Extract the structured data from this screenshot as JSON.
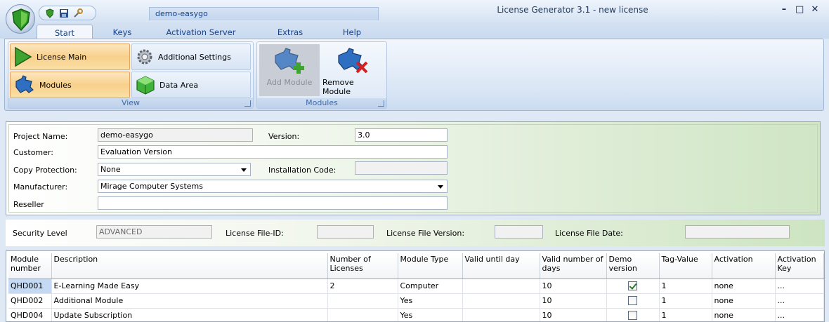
{
  "window": {
    "title": "License Generator 3.1 - new license",
    "document_tab": "demo-easygo",
    "controls": {
      "minimize": "–",
      "maximize": "□",
      "close": "✕"
    }
  },
  "ribbon": {
    "tabs": [
      "Start",
      "Keys",
      "Activation Server",
      "Extras",
      "Help"
    ],
    "active_tab": "Start",
    "view_group": {
      "label": "View",
      "buttons": {
        "license_main": "License Main",
        "additional_settings": "Additional Settings",
        "modules": "Modules",
        "data_area": "Data Area"
      }
    },
    "modules_group": {
      "label": "Modules",
      "add_module": "Add Module",
      "remove_module": "Remove Module"
    }
  },
  "form": {
    "project_name_label": "Project Name:",
    "project_name": "demo-easygo",
    "version_label": "Version:",
    "version": "3.0",
    "customer_label": "Customer:",
    "customer": "Evaluation Version",
    "copy_protection_label": "Copy Protection:",
    "copy_protection": "None",
    "installation_code_label": "Installation Code:",
    "installation_code": "",
    "manufacturer_label": "Manufacturer:",
    "manufacturer": "Mirage Computer Systems",
    "reseller_label": "Reseller",
    "reseller": ""
  },
  "security": {
    "security_level_label": "Security Level",
    "security_level": "ADVANCED",
    "license_file_id_label": "License File-ID:",
    "license_file_id": "",
    "license_file_version_label": "License File Version:",
    "license_file_version": "",
    "license_file_date_label": "License File Date:",
    "license_file_date": ""
  },
  "grid": {
    "columns": [
      "Module number",
      "Description",
      "Number of Licenses",
      "Module Type",
      "Valid until day",
      "Valid number of days",
      "Demo version",
      "Tag-Value",
      "Activation",
      "Activation Key"
    ],
    "rows": [
      {
        "module_number": "QHD001",
        "description": "E-Learning Made Easy",
        "licenses": "2",
        "type": "Computer",
        "valid_until": "",
        "valid_days": "10",
        "demo": true,
        "tag": "1",
        "activation": "none",
        "key": "..."
      },
      {
        "module_number": "QHD002",
        "description": "Additional Module",
        "licenses": "",
        "type": "Yes",
        "valid_until": "",
        "valid_days": "10",
        "demo": false,
        "tag": "1",
        "activation": "none",
        "key": "..."
      },
      {
        "module_number": "QHD004",
        "description": "Update Subscription",
        "licenses": "",
        "type": "Yes",
        "valid_until": "",
        "valid_days": "10",
        "demo": false,
        "tag": "1",
        "activation": "none",
        "key": "..."
      }
    ]
  }
}
